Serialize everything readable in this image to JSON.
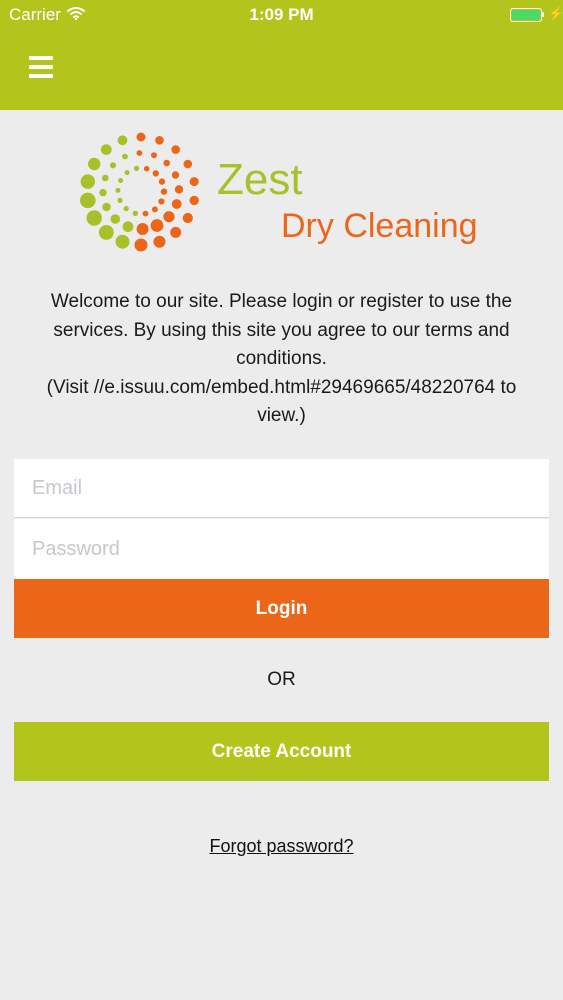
{
  "status_bar": {
    "carrier": "Carrier",
    "time": "1:09 PM",
    "wifi_icon": "wifi-icon",
    "battery_icon": "battery-icon"
  },
  "header": {
    "menu_icon": "hamburger-menu-icon",
    "background_color": "#b3c51c"
  },
  "logo": {
    "line1": "Zest",
    "line2": "Dry Cleaning",
    "green_color": "#a8c02a",
    "orange_color": "#ec661a"
  },
  "welcome": {
    "line1": "Welcome to our site. Please login or register to use the",
    "line2": "services. By using this site you agree to our terms and",
    "line3": "conditions.",
    "line4": "(Visit //e.issuu.com/embed.html#29469665/48220764 to",
    "line5": "view.)"
  },
  "form": {
    "email_placeholder": "Email",
    "email_value": "",
    "password_placeholder": "Password",
    "password_value": "",
    "login_label": "Login",
    "or_label": "OR",
    "create_account_label": "Create Account",
    "forgot_password_label": "Forgot password?"
  },
  "colors": {
    "accent_green": "#b3c51c",
    "accent_orange": "#ec661a",
    "background": "#ececec"
  }
}
